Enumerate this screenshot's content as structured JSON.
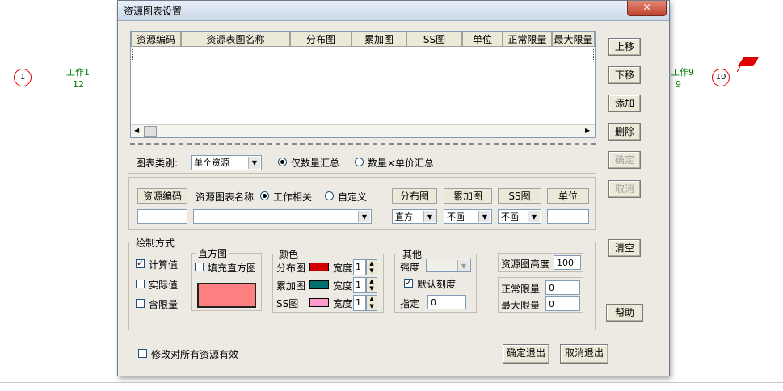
{
  "background": {
    "nodes": [
      "1",
      "10"
    ],
    "work_left": {
      "name": "工作1",
      "duration": "12"
    },
    "work_right": {
      "name": "工作9",
      "duration": "9"
    }
  },
  "dialog": {
    "title": "资源图表设置",
    "close_label": "✕",
    "grid": {
      "columns": [
        "资源编码",
        "资源表图名称",
        "分布图",
        "累加图",
        "SS图",
        "单位",
        "正常限量",
        "最大限量"
      ]
    },
    "side_buttons": {
      "up": "上移",
      "down": "下移",
      "add": "添加",
      "delete": "删除",
      "confirm": "确定",
      "cancel": "取消",
      "clear": "清空",
      "help": "帮助"
    },
    "chart_type": {
      "label": "图表类别:",
      "value": "单个资源",
      "radio_qty": "仅数量汇总",
      "radio_qty_price": "数量×单价汇总"
    },
    "resource": {
      "code_header": "资源编码",
      "name_header": "资源图表名称",
      "work_related": "工作相关",
      "custom": "自定义",
      "dist_header": "分布图",
      "cum_header": "累加图",
      "ss_header": "SS图",
      "unit_header": "单位",
      "dist_value": "直方",
      "cum_value": "不画",
      "ss_value": "不画"
    },
    "draw": {
      "group_label": "绘制方式",
      "calc": "计算值",
      "actual": "实际值",
      "limit": "含限量",
      "hist_group": "直方图",
      "fill_hist": "填充直方图",
      "color_group": "颜色",
      "dist_color_label": "分布图",
      "cum_color_label": "累加图",
      "ss_color_label": "SS图",
      "width_label": "宽度",
      "dist_width": "1",
      "cum_width": "1",
      "ss_width": "1",
      "other_group": "其他",
      "intensity": "强度",
      "default_scale": "默认刻度",
      "specify": "指定",
      "specify_value": "0",
      "height_label": "资源图高度",
      "height_value": "100",
      "normal_limit_label": "正常限量",
      "normal_limit_value": "0",
      "max_limit_label": "最大限量",
      "max_limit_value": "0"
    },
    "footer": {
      "apply_all": "修改对所有资源有效",
      "ok_exit": "确定退出",
      "cancel_exit": "取消退出"
    },
    "colors": {
      "dist": "#d40000",
      "cum": "#007070",
      "ss": "#ff99cc",
      "hist_fill": "#ff8080"
    }
  }
}
